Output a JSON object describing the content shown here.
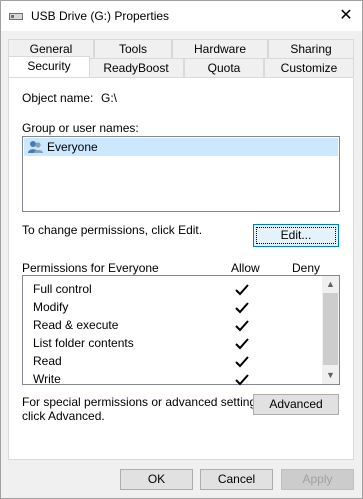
{
  "window": {
    "title": "USB Drive (G:) Properties"
  },
  "tabs_row1": [
    "General",
    "Tools",
    "Hardware",
    "Sharing"
  ],
  "tabs_row2": [
    "Security",
    "ReadyBoost",
    "Quota",
    "Customize"
  ],
  "security": {
    "object_name_label": "Object name:",
    "object_name_value": "G:\\",
    "group_label": "Group or user names:",
    "groups": [
      "Everyone"
    ],
    "change_text": "To change permissions, click Edit.",
    "edit_button": "Edit...",
    "permissions_label": "Permissions for Everyone",
    "allow_header": "Allow",
    "deny_header": "Deny",
    "permissions": [
      {
        "name": "Full control",
        "allow": true,
        "deny": false
      },
      {
        "name": "Modify",
        "allow": true,
        "deny": false
      },
      {
        "name": "Read & execute",
        "allow": true,
        "deny": false
      },
      {
        "name": "List folder contents",
        "allow": true,
        "deny": false
      },
      {
        "name": "Read",
        "allow": true,
        "deny": false
      },
      {
        "name": "Write",
        "allow": true,
        "deny": false
      }
    ],
    "special_text_line1": "For special permissions or advanced settings,",
    "special_text_line2": "click Advanced.",
    "advanced_button": "Advanced"
  },
  "footer": {
    "ok": "OK",
    "cancel": "Cancel",
    "apply": "Apply"
  }
}
